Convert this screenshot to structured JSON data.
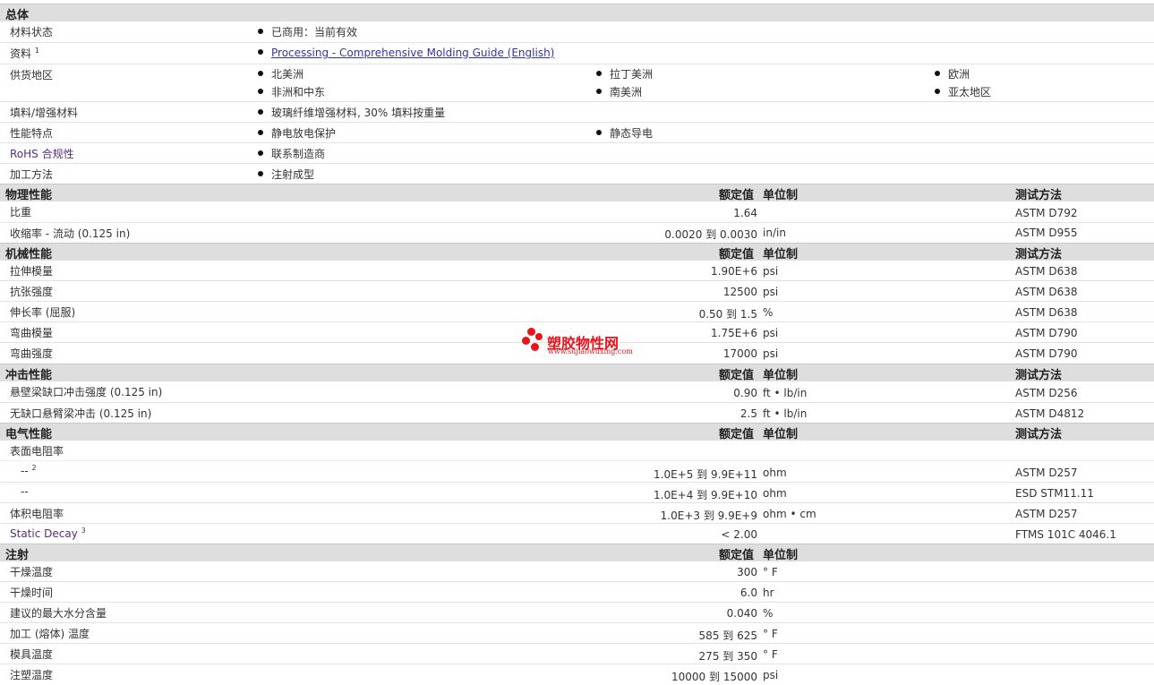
{
  "general": {
    "title": "总体",
    "rows": {
      "status": {
        "label": "材料状态",
        "items": [
          "已商用：当前有效"
        ]
      },
      "docs": {
        "label": "资料",
        "sup": "1",
        "link": "Processing - Comprehensive Molding Guide (English)"
      },
      "regions": {
        "label": "供货地区",
        "items": [
          "北美洲",
          "拉丁美洲",
          "欧洲",
          "非洲和中东",
          "南美洲",
          "亚太地区"
        ]
      },
      "filler": {
        "label": "填料/增强材料",
        "items": [
          "玻璃纤维增强材料, 30% 填料按重量"
        ]
      },
      "features": {
        "label": "性能特点",
        "items": [
          "静电放电保护",
          "静态导电"
        ]
      },
      "rohs": {
        "label": "RoHS 合规性",
        "items": [
          "联系制造商"
        ]
      },
      "method": {
        "label": "加工方法",
        "items": [
          "注射成型"
        ]
      }
    }
  },
  "headers": {
    "value": "额定值",
    "unit": "单位制",
    "method": "测试方法"
  },
  "physical": {
    "title": "物理性能",
    "rows": [
      {
        "label": "比重",
        "value": "1.64",
        "unit": "",
        "method": "ASTM D792"
      },
      {
        "label": "收缩率  - 流动 (0.125 in)",
        "value": "0.0020 到  0.0030",
        "unit": "in/in",
        "method": "ASTM D955"
      }
    ]
  },
  "mechanical": {
    "title": "机械性能",
    "rows": [
      {
        "label": "拉伸模量",
        "value": "1.90E+6",
        "unit": "psi",
        "method": "ASTM D638"
      },
      {
        "label": "抗张强度",
        "value": "12500",
        "unit": "psi",
        "method": "ASTM D638"
      },
      {
        "label": "伸长率 (屈服)",
        "value": "0.50 到  1.5",
        "unit": "%",
        "method": "ASTM D638"
      },
      {
        "label": "弯曲模量",
        "value": "1.75E+6",
        "unit": "psi",
        "method": "ASTM D790"
      },
      {
        "label": "弯曲强度",
        "value": "17000",
        "unit": "psi",
        "method": "ASTM D790"
      }
    ]
  },
  "impact": {
    "title": "冲击性能",
    "rows": [
      {
        "label": "悬壁梁缺口冲击强度 (0.125 in)",
        "value": "0.90",
        "unit": "ft • lb/in",
        "method": "ASTM D256"
      },
      {
        "label": "无缺口悬臂梁冲击 (0.125 in)",
        "value": "2.5",
        "unit": "ft • lb/in",
        "method": "ASTM D4812"
      }
    ]
  },
  "electrical": {
    "title": "电气性能",
    "surface_label": "表面电阻率",
    "rows": [
      {
        "label": "--",
        "sup": "2",
        "value": "1.0E+5 到  9.9E+11",
        "unit": "ohm",
        "method": "ASTM D257"
      },
      {
        "label": "--",
        "value": "1.0E+4 到  9.9E+10",
        "unit": "ohm",
        "method": "ESD STM11.11"
      },
      {
        "label": "体积电阻率",
        "value": "1.0E+3 到  9.9E+9",
        "unit": "ohm • cm",
        "method": "ASTM D257"
      },
      {
        "label": "Static Decay",
        "sup": "3",
        "value": "< 2.00",
        "unit": "",
        "method": "FTMS 101C 4046.1"
      }
    ]
  },
  "injection": {
    "title": "注射",
    "rows": [
      {
        "label": "干燥温度",
        "value": "300",
        "unit": "°  F"
      },
      {
        "label": "干燥时间",
        "value": "6.0",
        "unit": "hr"
      },
      {
        "label": "建议的最大水分含量",
        "value": "0.040",
        "unit": "%"
      },
      {
        "label": "加工 (熔体) 温度",
        "value": "585 到  625",
        "unit": "°  F"
      },
      {
        "label": "模具温度",
        "value": "275 到  350",
        "unit": "°  F"
      },
      {
        "label": "注塑温度",
        "value": "10000 到  15000",
        "unit": "psi"
      }
    ]
  },
  "watermark": {
    "title": "塑胶物性网",
    "url": "www.sujiaowuxing.com"
  },
  "colors": {
    "section_bg": "#dedede",
    "link": "#3333aa",
    "purple": "#5a2d7a",
    "watermark": "#e8141b"
  }
}
